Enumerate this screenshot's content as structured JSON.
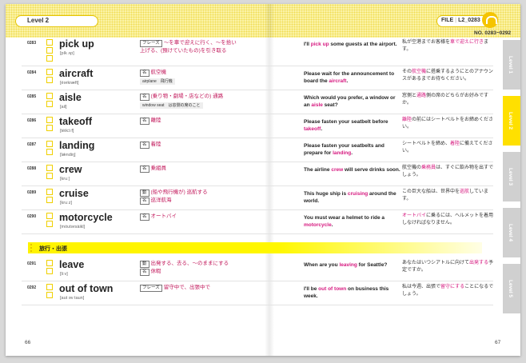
{
  "header": {
    "level_label": "Level 2",
    "file_label": "FILE",
    "file_code": "L2_0283",
    "range": "NO. 0283~0292"
  },
  "section_title": "旅行・出張",
  "entries": [
    {
      "no": "0283",
      "word": "pick up",
      "pron": "[pík ʌp]",
      "tag": "フレーズ",
      "def": "～を車で迎えに行く、～を拾い上げる、(預けていたもの)を引き取る",
      "note": "",
      "ex_pre": "I'll ",
      "ex_hl": "pick up",
      "ex_post": " some guests at the airport.",
      "ja_pre": "私が空港までお客様を",
      "ja_hl": "車で迎えに行き",
      "ja_post": "ます。"
    },
    {
      "no": "0284",
      "word": "aircraft",
      "pron": "[éərkræft]",
      "tag": "名",
      "def": "航空機",
      "note": "airplane　飛行機",
      "ex_pre": "Please wait for the announcement to board the ",
      "ex_hl": "aircraft",
      "ex_post": ".",
      "ja_pre": "その",
      "ja_hl": "航空機",
      "ja_post": "に搭乗するようにとのアナウンスがあるまでお待ちください。"
    },
    {
      "no": "0285",
      "word": "aisle",
      "pron": "[ail]",
      "tag": "名",
      "def": "(乗り物・劇場・店などの) 通路",
      "note": "window seat　は窓側の席のこと",
      "ex_pre": "Which would you prefer, a window or an ",
      "ex_hl": "aisle",
      "ex_post": " seat?",
      "ja_pre": "窓側と",
      "ja_hl": "通路",
      "ja_post": "側の席のどちらがお好みですか。"
    },
    {
      "no": "0286",
      "word": "takeoff",
      "pron": "[téikɔ̀ːf]",
      "tag": "名",
      "def": "離陸",
      "note": "",
      "ex_pre": "Please fasten your seatbelt before ",
      "ex_hl": "takeoff",
      "ex_post": ".",
      "ja_pre": "",
      "ja_hl": "離陸",
      "ja_post": "の前にはシートベルトをお締めください。"
    },
    {
      "no": "0287",
      "word": "landing",
      "pron": "[lǽndiŋ]",
      "tag": "名",
      "def": "着陸",
      "note": "",
      "ex_pre": "Please fasten your seatbelts and prepare for ",
      "ex_hl": "landing",
      "ex_post": ".",
      "ja_pre": "シートベルトを締め、",
      "ja_hl": "着陸",
      "ja_post": "に備えてください。"
    },
    {
      "no": "0288",
      "word": "crew",
      "pron": "[kruː]",
      "tag": "名",
      "def": "乗組員",
      "note": "",
      "ex_pre": "The airline ",
      "ex_hl": "crew",
      "ex_post": " will serve drinks soon.",
      "ja_pre": "航空機の",
      "ja_hl": "乗務員",
      "ja_post": "は、すぐに飲み物を出すでしょう。"
    },
    {
      "no": "0289",
      "word": "cruise",
      "pron": "[kruːz]",
      "tag": "動",
      "def": "(船や飛行機が) 巡航する",
      "tag2": "名",
      "def2": "巡洋航海",
      "note": "",
      "ex_pre": "This huge ship is ",
      "ex_hl": "cruising",
      "ex_post": " around the world.",
      "ja_pre": "この巨大な船は、世界中を",
      "ja_hl": "巡航",
      "ja_post": "しています。"
    },
    {
      "no": "0290",
      "word": "motorcycle",
      "pron": "[móutərsàikl]",
      "tag": "名",
      "def": "オートバイ",
      "note": "",
      "ex_pre": "You must wear a helmet to ride a ",
      "ex_hl": "motorcycle",
      "ex_post": ".",
      "ja_pre": "",
      "ja_hl": "オートバイ",
      "ja_post": "に乗るには、ヘルメットを着用しなければなりません。"
    },
    {
      "no": "0291",
      "word": "leave",
      "pron": "[liːv]",
      "tag": "動",
      "def": "出発する、去る、～のままにする",
      "tag2": "名",
      "def2": "休暇",
      "note": "",
      "ex_pre": "When are you ",
      "ex_hl": "leaving",
      "ex_post": " for Seattle?",
      "ja_pre": "あなたはいつシアトルに向けて",
      "ja_hl": "出発する",
      "ja_post": "予定ですか。"
    },
    {
      "no": "0292",
      "word": "out of town",
      "pron": "[aut əv taun]",
      "tag": "フレーズ",
      "def": "留守中で、出張中で",
      "note": "",
      "ex_pre": "I'll be ",
      "ex_hl": "out of town",
      "ex_post": " on business this week.",
      "ja_pre": "私は今週、出張で",
      "ja_hl": "留守にする",
      "ja_post": "ことになるでしょう。"
    }
  ],
  "tabs": [
    "Level 1",
    "Level 2",
    "Level 3",
    "Level 4",
    "Level 5"
  ],
  "pages": {
    "left": "66",
    "right": "67"
  }
}
